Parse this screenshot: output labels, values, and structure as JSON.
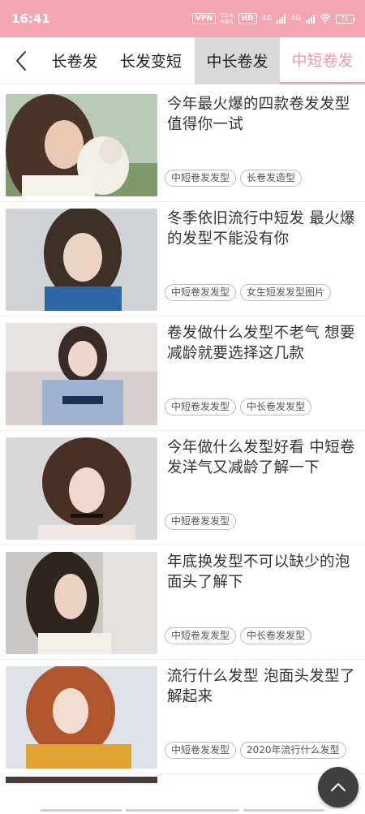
{
  "status_bar": {
    "time": "16:41",
    "vpn": "VPN",
    "speed_value": "53.4",
    "speed_unit": "KB/s",
    "hd": "HD",
    "network_1": "4G",
    "network_2": "4G",
    "battery": "71"
  },
  "tabs": [
    {
      "label": "长卷发"
    },
    {
      "label": "长发变短"
    },
    {
      "label": "中长卷发"
    },
    {
      "label": "中短卷发"
    }
  ],
  "articles": [
    {
      "title": "今年最火爆的四款卷发发型值得你一试",
      "tags": [
        "中短卷发发型",
        "长卷发造型"
      ]
    },
    {
      "title": "冬季依旧流行中短发 最火爆的发型不能没有你",
      "tags": [
        "中短卷发发型",
        "女生短发发型图片"
      ]
    },
    {
      "title": "卷发做什么发型不老气 想要减龄就要选择这几款",
      "tags": [
        "中短卷发发型",
        "中长卷发发型"
      ]
    },
    {
      "title": "今年做什么发型好看 中短卷发洋气又减龄了解一下",
      "tags": [
        "中短卷发发型"
      ]
    },
    {
      "title": "年底换发型不可以缺少的泡面头了解下",
      "tags": [
        "中短卷发发型",
        "中长卷发发型"
      ]
    },
    {
      "title": "流行什么发型 泡面头发型了解起来",
      "tags": [
        "中短卷发发型",
        "2020年流行什么发型"
      ]
    }
  ],
  "colors": {
    "status_bar_bg": "#f4a6b2",
    "active_tab": "#f39aa8",
    "selected_tab_bg": "#d9d9d9"
  }
}
